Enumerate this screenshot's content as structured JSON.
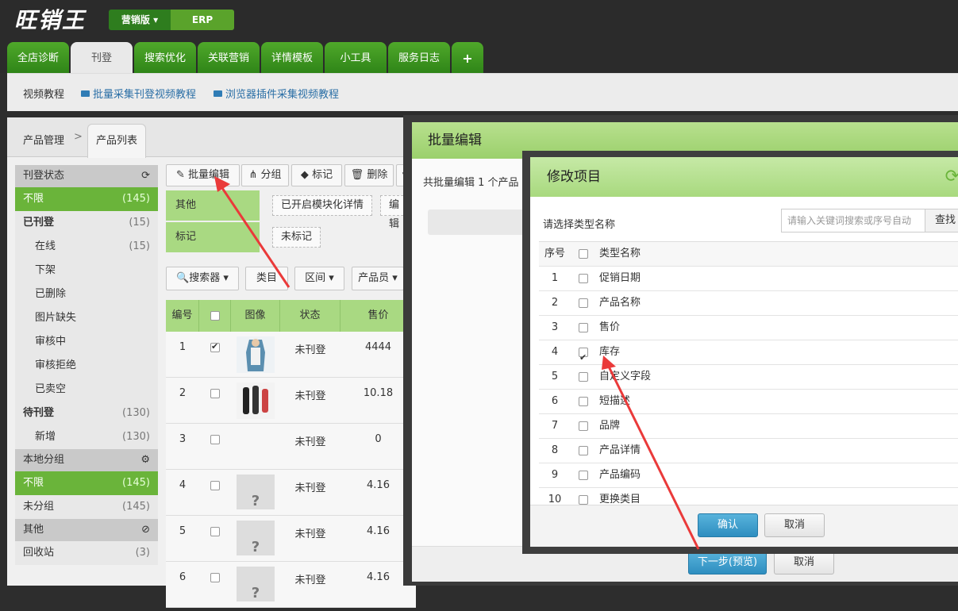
{
  "app": {
    "logo": "旺销王",
    "version_tab": "营销版 ▾",
    "erp_tab": "ERP"
  },
  "tabs": [
    "全店诊断",
    "刊登",
    "搜索优化",
    "关联营销",
    "详情模板",
    "小工具",
    "服务日志",
    "+"
  ],
  "subbar": {
    "video": "视频教程",
    "link1": "批量采集刊登视频教程",
    "link2": "浏览器插件采集视频教程"
  },
  "breadcrumb": {
    "item1": "产品管理",
    "sep": ">",
    "item2": "产品列表"
  },
  "sidebar": {
    "status_head": "刊登状态",
    "status_items": [
      {
        "label": "不限",
        "count": "(145)"
      },
      {
        "label": "已刊登",
        "count": "(15)"
      },
      {
        "label": "在线",
        "count": "(15)"
      },
      {
        "label": "下架",
        "count": ""
      },
      {
        "label": "已删除",
        "count": ""
      },
      {
        "label": "图片缺失",
        "count": ""
      },
      {
        "label": "审核中",
        "count": ""
      },
      {
        "label": "审核拒绝",
        "count": ""
      },
      {
        "label": "已卖空",
        "count": ""
      },
      {
        "label": "待刊登",
        "count": "(130)"
      },
      {
        "label": "新增",
        "count": "(130)"
      }
    ],
    "group_head": "本地分组",
    "group_items": [
      {
        "label": "不限",
        "count": "(145)"
      },
      {
        "label": "未分组",
        "count": "(145)"
      }
    ],
    "other_head": "其他",
    "other_items": [
      {
        "label": "回收站",
        "count": "(3)"
      }
    ]
  },
  "toolbar": {
    "batch_edit": "批量编辑",
    "group": "分组",
    "mark": "标记",
    "delete": "删除"
  },
  "filters": {
    "other_label": "其他",
    "other_chip1": "已开启模块化详情",
    "other_chip2": "编辑",
    "mark_label": "标记",
    "mark_chip": "未标记"
  },
  "search": {
    "searcher": "搜索器 ▾",
    "category": "类目",
    "range": "区间 ▾",
    "staff": "产品员 ▾"
  },
  "table": {
    "headers": [
      "编号",
      "",
      "图像",
      "状态",
      "售价"
    ],
    "rows": [
      {
        "no": "1",
        "status": "未刊登",
        "price": "4444",
        "img": "photo1",
        "checked": true
      },
      {
        "no": "2",
        "status": "未刊登",
        "price": "10.18",
        "img": "photo2",
        "checked": false
      },
      {
        "no": "3",
        "status": "未刊登",
        "price": "0",
        "img": "",
        "checked": false
      },
      {
        "no": "4",
        "status": "未刊登",
        "price": "4.16",
        "img": "?",
        "checked": false
      },
      {
        "no": "5",
        "status": "未刊登",
        "price": "4.16",
        "img": "?",
        "checked": false
      },
      {
        "no": "6",
        "status": "未刊登",
        "price": "4.16",
        "img": "?",
        "checked": false
      }
    ]
  },
  "batch_dialog": {
    "title": "批量编辑",
    "info": "共批量编辑 1 个产品",
    "next": "下一步(预览)",
    "cancel": "取消"
  },
  "modify_dialog": {
    "title": "修改项目",
    "label": "请选择类型名称",
    "search_placeholder": "请输入关键词搜索或序号自动",
    "search_btn": "查找",
    "col_no": "序号",
    "col_name": "类型名称",
    "items": [
      {
        "no": "1",
        "name": "促销日期",
        "checked": false
      },
      {
        "no": "2",
        "name": "产品名称",
        "checked": false
      },
      {
        "no": "3",
        "name": "售价",
        "checked": false
      },
      {
        "no": "4",
        "name": "库存",
        "checked": true
      },
      {
        "no": "5",
        "name": "自定义字段",
        "checked": false
      },
      {
        "no": "6",
        "name": "短描述",
        "checked": false
      },
      {
        "no": "7",
        "name": "品牌",
        "checked": false
      },
      {
        "no": "8",
        "name": "产品详情",
        "checked": false
      },
      {
        "no": "9",
        "name": "产品编码",
        "checked": false
      },
      {
        "no": "10",
        "name": "更换类目",
        "checked": false
      }
    ],
    "confirm": "确认",
    "cancel": "取消"
  },
  "colors": {
    "green": "#6ab43a",
    "dark_green": "#2f8518",
    "blue": "#2e8ec0",
    "arrow": "#ea3a3a"
  }
}
